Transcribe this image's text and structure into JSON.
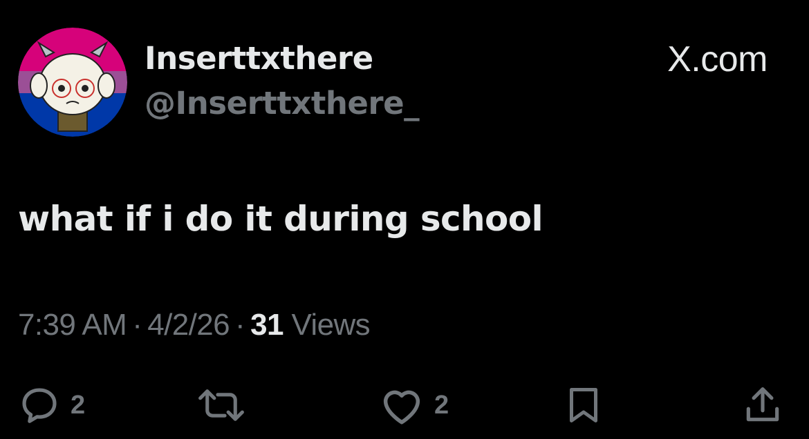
{
  "header": {
    "display_name": "Inserttxthere",
    "handle": "@Inserttxthere_",
    "brand": "X.com"
  },
  "tweet": {
    "text": "what if i do it during school"
  },
  "meta": {
    "time": "7:39 AM",
    "separator": "·",
    "date": "4/2/26",
    "views_count": "31",
    "views_label": "Views"
  },
  "actions": {
    "replies": {
      "icon": "reply-icon",
      "count": "2"
    },
    "reposts": {
      "icon": "repost-icon"
    },
    "likes": {
      "icon": "heart-icon",
      "count": "2"
    },
    "bookmark": {
      "icon": "bookmark-icon"
    },
    "share": {
      "icon": "share-icon"
    }
  },
  "colors": {
    "background": "#000000",
    "primary_text": "#e7e9ea",
    "secondary_text": "#71767b",
    "avatar_ring_top": "#d6027a",
    "avatar_ring_middle": "#9b4f96",
    "avatar_ring_bottom": "#0038a8"
  }
}
